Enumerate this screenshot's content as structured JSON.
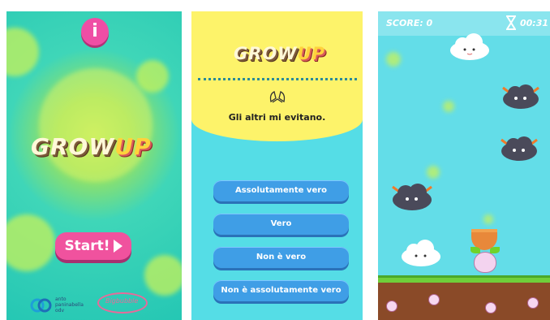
{
  "panel1": {
    "info_label": "i",
    "logo_grow": "GROW",
    "logo_up": "UP",
    "start_label": "Start!",
    "sponsor_line1": "anto",
    "sponsor_line2": "paninabella",
    "sponsor_line3": "odv",
    "sponsor2_text": "Bigbubble"
  },
  "panel2": {
    "logo_grow": "GROW",
    "logo_up": "UP",
    "question": "Gli altri mi evitano.",
    "answers": [
      "Assolutamente vero",
      "Vero",
      "Non è vero",
      "Non è assolutamente vero"
    ]
  },
  "panel3": {
    "score": "SCORE: 0",
    "timer": "00:31"
  },
  "colors": {
    "accent_pink": "#ef4ea5",
    "answer_blue": "#3f9ee6",
    "question_yellow": "#fdf36a",
    "teal_bg": "#55dde6"
  },
  "icons": [
    "info-icon",
    "play-arrow-icon",
    "hourglass-icon",
    "hands-icon"
  ]
}
